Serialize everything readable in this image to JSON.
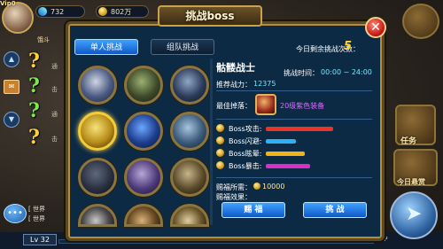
{
  "hud": {
    "vip": "Vip0",
    "gems": "732",
    "gold": "802万",
    "level": "Lv 32",
    "exp_label": "EXP",
    "left_chat_1": "[ 世界",
    "left_chat_2": "[ 世界",
    "left_name": "饿斗",
    "left_text_1": "通",
    "left_text_2": "击",
    "left_text_3": "通",
    "left_text_4": "击",
    "right_menu_1": "任务",
    "right_menu_2": "今日悬赏"
  },
  "dialog": {
    "title": "挑战boss",
    "close_icon": "close-x-icon",
    "tabs": [
      {
        "label": "单人挑战",
        "active": true
      },
      {
        "label": "组队挑战",
        "active": false
      }
    ],
    "remaining_label": "今日剩余挑战次数：",
    "remaining_value": "5",
    "boss": {
      "name": "骷髅战士",
      "time_label": "挑战时间：",
      "time_value": "00:00 ~ 24:00",
      "power_label": "推荐战力：",
      "power_value": "12375",
      "drop_label": "最佳掉落：",
      "drop_value": "20级紫色装备",
      "stats": [
        {
          "label": "Boss攻击:",
          "value": 0.95,
          "color": "#e8352a"
        },
        {
          "label": "Boss闪避:",
          "value": 0.42,
          "color": "#2bb2f2"
        },
        {
          "label": "Boss眩晕:",
          "value": 0.55,
          "color": "#f2b21a"
        },
        {
          "label": "Boss暴击:",
          "value": 0.62,
          "color": "#d630c9"
        }
      ],
      "bless_cost_label": "赐福所需：",
      "bless_cost_value": "10000",
      "bless_effect_label": "赐福效果："
    },
    "buttons": {
      "bless": "赐 福",
      "challenge": "挑 战"
    }
  }
}
